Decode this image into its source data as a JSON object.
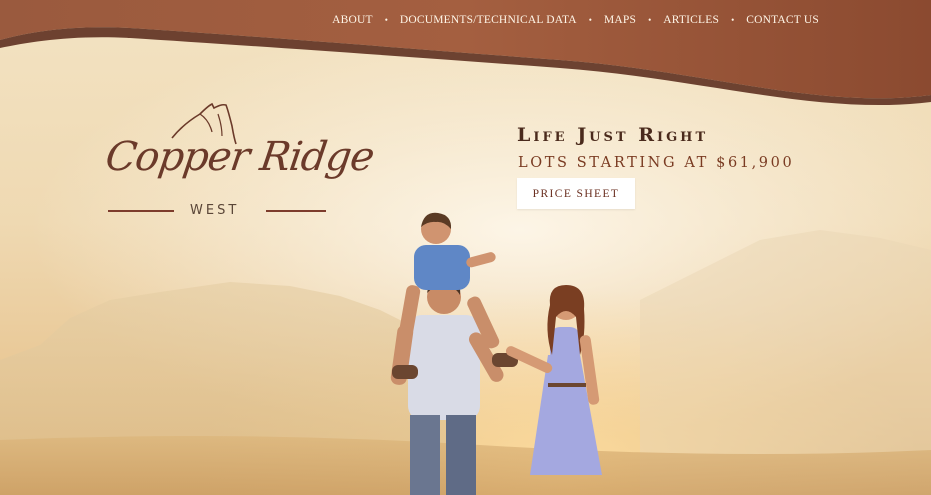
{
  "nav": {
    "items": [
      {
        "label": "ABOUT"
      },
      {
        "label": "DOCUMENTS/TECHNICAL DATA"
      },
      {
        "label": "MAPS"
      },
      {
        "label": "ARTICLES"
      },
      {
        "label": "CONTACT US"
      }
    ],
    "separator": "•"
  },
  "logo": {
    "name": "Copper Ridge",
    "sub": "WEST"
  },
  "hero": {
    "tagline": "Life Just Right",
    "subline": "LOTS STARTING AT $61,900",
    "cta_label": "PRICE SHEET"
  },
  "colors": {
    "header_brown": "#8a4a33",
    "accent_copper": "#7a3b22",
    "background_sand": "#f2dfbd"
  }
}
